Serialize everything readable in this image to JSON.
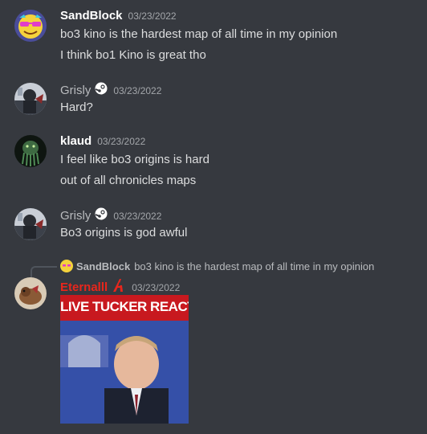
{
  "messages": [
    {
      "author": "SandBlock",
      "author_color": "#ffffff",
      "timestamp": "03/23/2022",
      "avatar_icon": "sunglasses-emoji-avatar",
      "lines": [
        "bo3 kino is the hardest map of all time in my opinion",
        "I think bo1 Kino is great tho"
      ]
    },
    {
      "author": "Grisly",
      "author_color": "#b9bbbe",
      "timestamp": "03/23/2022",
      "badge_icon": "steam-icon",
      "avatar_icon": "dark-character-avatar",
      "lines": [
        "Hard?"
      ]
    },
    {
      "author": "klaud",
      "author_color": "#ffffff",
      "timestamp": "03/23/2022",
      "avatar_icon": "green-creature-avatar",
      "lines": [
        "I feel like bo3 origins is hard",
        "out of all chronicles maps"
      ]
    },
    {
      "author": "Grisly",
      "author_color": "#b9bbbe",
      "timestamp": "03/23/2022",
      "badge_icon": "steam-icon",
      "avatar_icon": "dark-character-avatar",
      "lines": [
        "Bo3 origins is god awful"
      ]
    },
    {
      "author": "Eternalll",
      "author_color": "#e8261c",
      "timestamp": "03/23/2022",
      "badge_icon": "red-a-logo-icon",
      "avatar_icon": "brown-animal-avatar",
      "reply_to": {
        "author": "SandBlock",
        "text": "bo3 kino is the hardest map of all time in my opinion"
      },
      "embed": {
        "banner_text": "LIVE TUCKER REACTION"
      }
    }
  ]
}
